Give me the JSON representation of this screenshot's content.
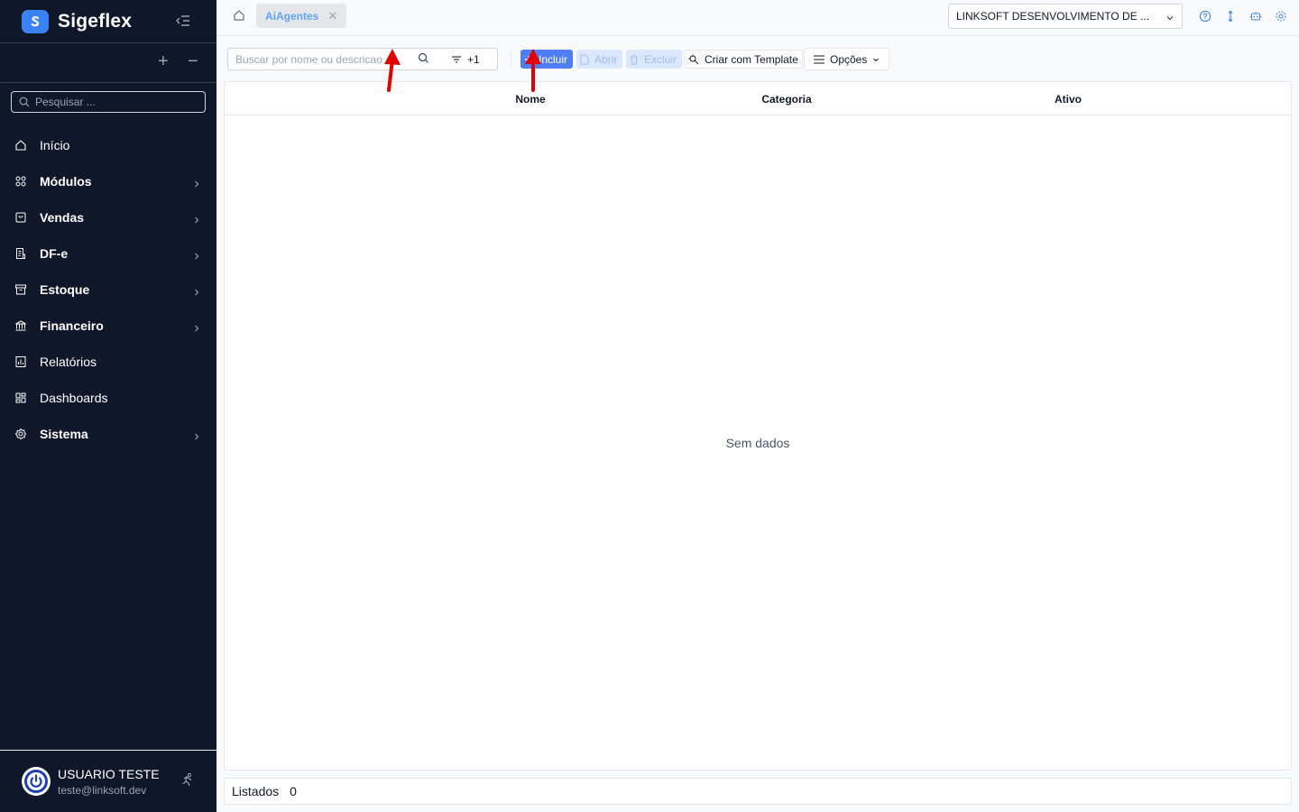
{
  "app": {
    "name": "Sigeflex"
  },
  "sidebar": {
    "search_placeholder": "Pesquisar ...",
    "items": [
      {
        "label": "Início",
        "icon": "home-icon",
        "bold": false,
        "chevron": false
      },
      {
        "label": "Módulos",
        "icon": "grid-icon",
        "bold": true,
        "chevron": true
      },
      {
        "label": "Vendas",
        "icon": "shopping-bag-icon",
        "bold": true,
        "chevron": true
      },
      {
        "label": "DF-e",
        "icon": "document-icon",
        "bold": true,
        "chevron": true
      },
      {
        "label": "Estoque",
        "icon": "archive-box-icon",
        "bold": true,
        "chevron": true
      },
      {
        "label": "Financeiro",
        "icon": "bank-icon",
        "bold": true,
        "chevron": true
      },
      {
        "label": "Relatórios",
        "icon": "report-icon",
        "bold": false,
        "chevron": false
      },
      {
        "label": "Dashboards",
        "icon": "dashboard-icon",
        "bold": false,
        "chevron": false
      },
      {
        "label": "Sistema",
        "icon": "settings-icon",
        "bold": true,
        "chevron": true
      }
    ],
    "user": {
      "name": "USUARIO TESTE",
      "email": "teste@linksoft.dev"
    }
  },
  "header": {
    "tabs": [
      {
        "label": "AiAgentes"
      }
    ],
    "company": "LINKSOFT DESENVOLVIMENTO DE ..."
  },
  "toolbar": {
    "search_placeholder": "Buscar por nome ou descricao",
    "filter_count": "+1",
    "incluir": "Incluir",
    "abrir": "Abrir",
    "excluir": "Excluir",
    "template": "Criar com Template",
    "opcoes": "Opções"
  },
  "table": {
    "columns": [
      "Nome",
      "Categoria",
      "Ativo"
    ],
    "empty": "Sem dados"
  },
  "status": {
    "label": "Listados",
    "count": "0"
  },
  "colors": {
    "sidebar_bg": "#0f172a",
    "primary": "#4f7df3",
    "annotation_arrow": "#e00000"
  }
}
